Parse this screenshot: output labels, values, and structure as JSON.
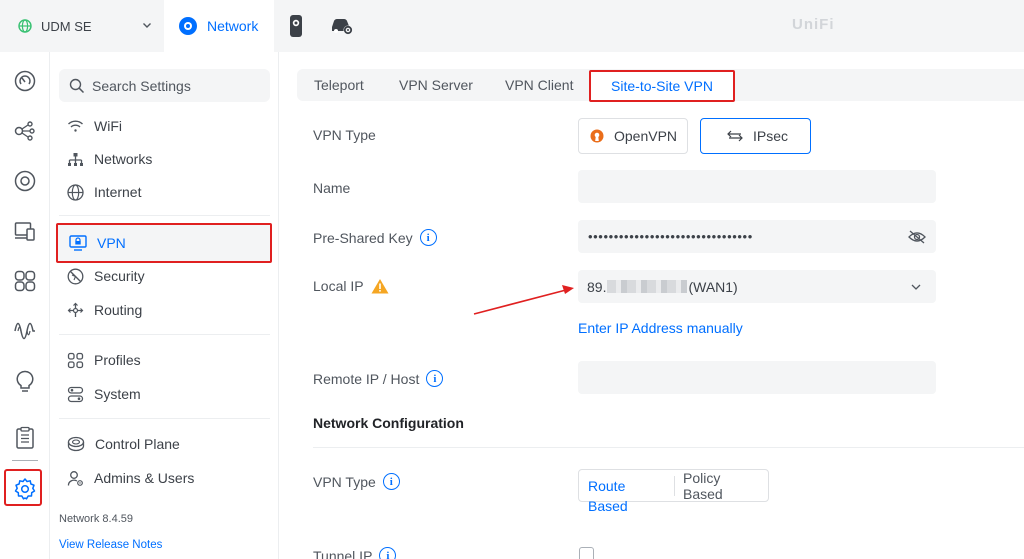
{
  "topbar": {
    "device_name": "UDM SE",
    "app_tab_label": "Network",
    "brand": "UniFi"
  },
  "rail": {
    "icons": [
      "dashboard-icon",
      "topology-icon",
      "devices-icon",
      "client-devices-icon",
      "ports-icon",
      "insights-icon",
      "innerspace-icon",
      "logs-icon",
      "settings-icon"
    ]
  },
  "sidebar": {
    "search_placeholder": "Search Settings",
    "items": [
      {
        "label": "WiFi",
        "icon": "wifi-icon"
      },
      {
        "label": "Networks",
        "icon": "networks-icon"
      },
      {
        "label": "Internet",
        "icon": "internet-icon"
      },
      {
        "label": "VPN",
        "icon": "vpn-icon",
        "active": true
      },
      {
        "label": "Security",
        "icon": "security-icon"
      },
      {
        "label": "Routing",
        "icon": "routing-icon"
      },
      {
        "label": "Profiles",
        "icon": "profiles-icon"
      },
      {
        "label": "System",
        "icon": "system-icon"
      },
      {
        "label": "Control Plane",
        "icon": "control-plane-icon"
      },
      {
        "label": "Admins & Users",
        "icon": "admins-icon"
      }
    ],
    "version": "Network 8.4.59",
    "release_notes": "View Release Notes"
  },
  "main": {
    "tabs": [
      {
        "label": "Teleport"
      },
      {
        "label": "VPN Server"
      },
      {
        "label": "VPN Client"
      },
      {
        "label": "Site-to-Site VPN",
        "active": true
      }
    ],
    "vpn_type_label": "VPN Type",
    "vpn_type_options": [
      "OpenVPN",
      "IPsec"
    ],
    "vpn_type_selected": "IPsec",
    "name_label": "Name",
    "name_value": "",
    "psk_label": "Pre-Shared Key",
    "psk_value": "••••••••••••••••••••••••••••••••",
    "local_ip_label": "Local IP",
    "local_ip_prefix": "89.",
    "local_ip_suffix": "(WAN1)",
    "enter_manual": "Enter IP Address manually",
    "remote_label": "Remote IP / Host",
    "remote_value": "",
    "network_config_title": "Network Configuration",
    "vpn_type2_label": "VPN Type",
    "segment_options": [
      "Route Based",
      "Policy Based"
    ],
    "segment_selected": "Route Based",
    "tunnel_ip_label": "Tunnel IP"
  },
  "colors": {
    "accent": "#006fff",
    "highlight_box": "#e02020",
    "warning": "#f5a623",
    "openvpn": "#ea6d1a"
  }
}
